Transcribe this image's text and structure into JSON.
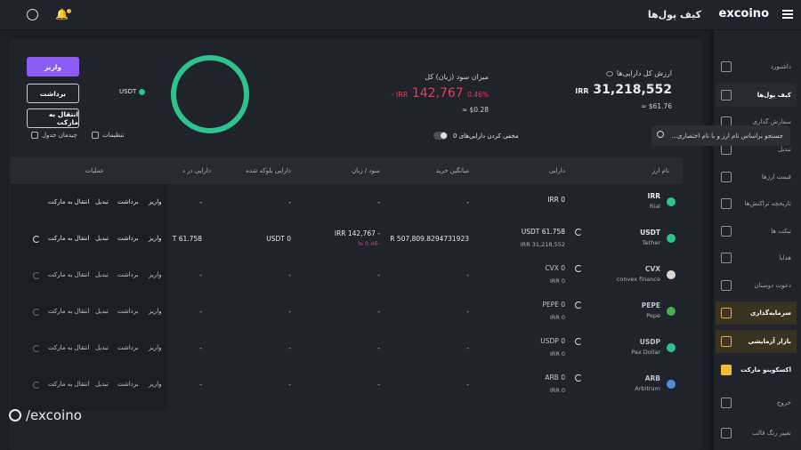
{
  "header": {
    "title": "کیف پول‌ها",
    "logo": "excoino"
  },
  "sidebar": {
    "items": [
      {
        "label": "داشبورد",
        "icon": "dashboard-icon"
      },
      {
        "label": "کیف پول‌ها",
        "icon": "wallet-icon"
      },
      {
        "label": "سفارش گذاری",
        "icon": "order-icon"
      },
      {
        "label": "تبدیل",
        "icon": "swap-icon"
      },
      {
        "label": "قیمت ارزها",
        "icon": "chart-icon"
      },
      {
        "label": "تاریخچه تراکنش‌ها",
        "icon": "history-icon"
      },
      {
        "label": "تیکت ها",
        "icon": "headset-icon"
      },
      {
        "label": "هدایا",
        "icon": "gift-icon"
      },
      {
        "label": "دعوت دوستان",
        "icon": "invite-icon"
      },
      {
        "label": "سرمایه‌گذاری",
        "icon": "invest-icon"
      },
      {
        "label": "بازار آزمایشی",
        "icon": "demo-market-icon"
      },
      {
        "label": "اکسکوینو مارکت",
        "icon": "excoino-market-icon"
      },
      {
        "label": "خروج",
        "icon": "power-icon"
      },
      {
        "label": "تغییر رنگ قالب",
        "icon": "sun-icon"
      }
    ]
  },
  "summary": {
    "total_title": "ارزش کل دارایی‌ها",
    "total_value": "31,218,552",
    "total_unit": "IRR",
    "total_usd": "$61.76",
    "profit_title": "میزان سود (زیان) کل",
    "profit_value": "142,767",
    "profit_unit": "IRR -",
    "profit_percent": "0.46%",
    "profit_usd": "$0.28",
    "approx": "≈",
    "legend_label": "USDT"
  },
  "actions": {
    "deposit": "واریز",
    "withdraw": "برداشت",
    "transfer": "انتقال به مارکت"
  },
  "toolbar": {
    "search_placeholder": "جستجو براساس نام ارز و یا نام اختصاری...",
    "hide_zero": "مخفی کردن دارایی‌های 0",
    "settings": "تنظیمات",
    "layout": "چیدمان جدول"
  },
  "table": {
    "headers": {
      "name": "نام ارز",
      "balance": "دارایی",
      "avg_buy": "میانگین خرید",
      "pnl": "سود / زیان",
      "blocked": "دارایی بلوکه شده",
      "in_orders": "دارایی در د",
      "ops": "عملیات"
    },
    "ops_labels": {
      "deposit": "واریز",
      "withdraw": "برداشت",
      "convert": "تبدیل",
      "transfer": "انتقال به مارکت"
    },
    "rows": [
      {
        "symbol": "IRR",
        "name": "Rial",
        "balance": "IRR 0",
        "balance_sub": "",
        "avg": "-",
        "pnl": "-",
        "pnl_pct": "",
        "blocked": "-",
        "in_orders": "-",
        "color": "#2ec28f"
      },
      {
        "symbol": "USDT",
        "name": "Tether",
        "balance": "USDT 61.758",
        "balance_sub": "IRR 31,218,552",
        "avg": "R 507,809.8294731923",
        "pnl": "- IRR 142,767",
        "pnl_pct": "-0.46 %",
        "blocked": "USDT 0",
        "in_orders": "T 61.758",
        "color": "#2ec28f"
      },
      {
        "symbol": "CVX",
        "name": "convex finance",
        "balance": "CVX 0",
        "balance_sub": "IRR 0",
        "avg": "-",
        "pnl": "-",
        "pnl_pct": "",
        "blocked": "-",
        "in_orders": "-",
        "color": "#d8d8d8"
      },
      {
        "symbol": "PEPE",
        "name": "Pepe",
        "balance": "PEPE 0",
        "balance_sub": "IRR 0",
        "avg": "-",
        "pnl": "-",
        "pnl_pct": "",
        "blocked": "-",
        "in_orders": "-",
        "color": "#4caf50"
      },
      {
        "symbol": "USDP",
        "name": "Pax Dollar",
        "balance": "USDP 0",
        "balance_sub": "IRR 0",
        "avg": "-",
        "pnl": "-",
        "pnl_pct": "",
        "blocked": "-",
        "in_orders": "-",
        "color": "#2ec28f"
      },
      {
        "symbol": "ARB",
        "name": "Arbitrum",
        "balance": "ARB 0",
        "balance_sub": "IRR 0",
        "avg": "-",
        "pnl": "-",
        "pnl_pct": "",
        "blocked": "-",
        "in_orders": "-",
        "color": "#4a90e2"
      }
    ]
  },
  "watermark": "/excoino"
}
